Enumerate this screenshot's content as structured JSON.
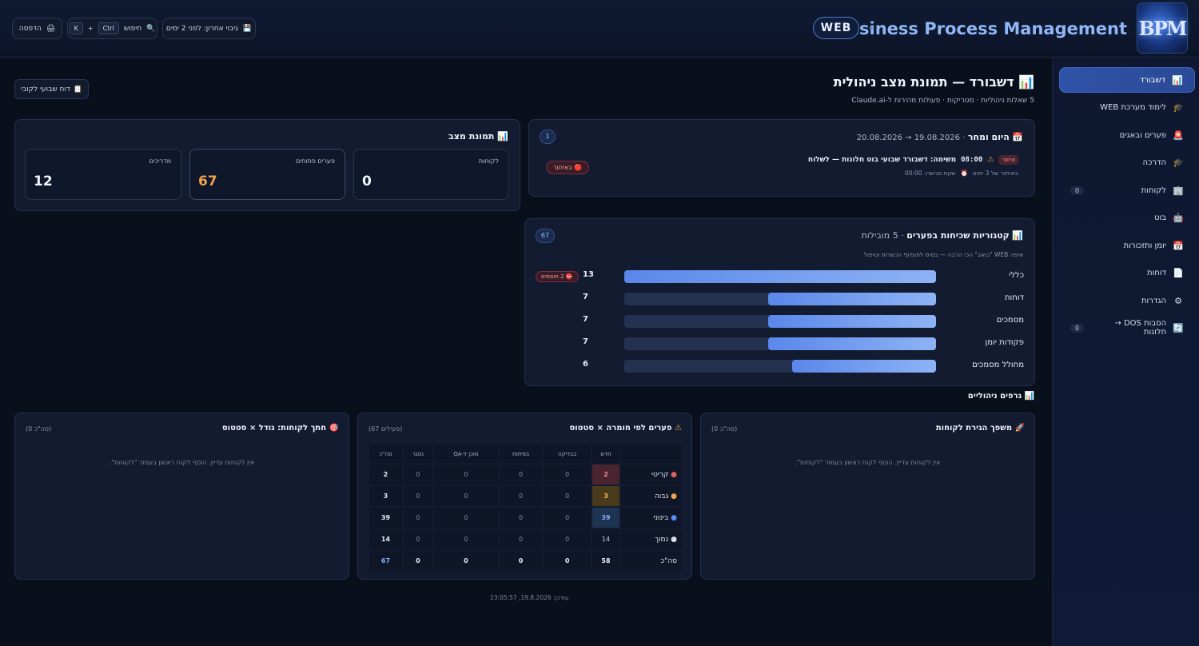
{
  "header": {
    "logo_text": "BPM",
    "app_title": "Business Process Management",
    "badge": "WEB",
    "dot": "•",
    "backup_label": "גיבוי אחרון: לפני 2 ימים",
    "search_label": "חיפוש",
    "kbd_ctrl": "Ctrl",
    "kbd_plus": "+",
    "kbd_k": "K",
    "print_label": "הדפסה"
  },
  "sidebar": {
    "items": [
      {
        "label": "דשבורד",
        "icon": "📊",
        "count": ""
      },
      {
        "label": "לימוד מערכת WEB",
        "icon": "🎓",
        "count": ""
      },
      {
        "label": "פערים ובאגים",
        "icon": "🚨",
        "count": ""
      },
      {
        "label": "הדרכה",
        "icon": "🎓",
        "count": ""
      },
      {
        "label": "לקוחות",
        "icon": "🏢",
        "count": "0"
      },
      {
        "label": "בוט",
        "icon": "🤖",
        "count": ""
      },
      {
        "label": "יומן ותזכורות",
        "icon": "📅",
        "count": ""
      },
      {
        "label": "דוחות",
        "icon": "📄",
        "count": ""
      },
      {
        "label": "הגדרות",
        "icon": "⚙",
        "count": ""
      },
      {
        "label": "הסבות DOS → חלונות",
        "icon": "🔄",
        "count": "0"
      }
    ]
  },
  "page": {
    "title": "דשבורד — תמונת מצב ניהולית",
    "title_icon": "📊",
    "subtitle": "5 שאלות ניהוליות · מטריקות · פעולות מהירות ל-Claude.ai",
    "weekly_report": "דוח שבועי לקובי",
    "weekly_icon": "📋"
  },
  "status": {
    "title": "תמונת מצב",
    "icon": "📊",
    "stats": [
      {
        "label": "לקוחות",
        "value": "0",
        "color": "#f2f5fb"
      },
      {
        "label": "פערים פתוחים",
        "value": "67",
        "color": "#f0a24b"
      },
      {
        "label": "מדריכים",
        "value": "12",
        "color": "#f2f5fb"
      }
    ]
  },
  "today": {
    "title": "היום ומחר",
    "icon": "📅",
    "range": "· 19.08.2026 → 20.08.2026",
    "count": "1",
    "task_time": "08:00",
    "task_text": "משימה: דשבורד שבועי בוט חלונות — לשלוח",
    "late_tag": "איחור",
    "late_by": "באיחור של 3 ימים",
    "meet_time": "שעת פגישה: 00:00",
    "status_btn": "באיחור"
  },
  "categories": {
    "title": "קטגוריות שכיחות בפערים",
    "icon": "📊",
    "suffix": "· 5 מובילות",
    "subtitle": "איפה WEB \"כואב\" הכי הרבה — בסיס לתעדוף הכשרות וטיפול",
    "count": "67",
    "missing": "2 חוסמים",
    "rows": [
      {
        "label": "כללי",
        "value": 13
      },
      {
        "label": "דוחות",
        "value": 7
      },
      {
        "label": "מסמכים",
        "value": 7
      },
      {
        "label": "פקודות יומן",
        "value": 7
      },
      {
        "label": "מחולל מסמכים",
        "value": 6
      }
    ]
  },
  "charts_heading": {
    "title": "גרפים ניהוליים",
    "icon": "📊"
  },
  "launch": {
    "title": "משפך הגירת לקוחות",
    "icon": "🚀",
    "total": "(0 סה\"כ)",
    "empty": "אין לקוחות עדיין. הוסף לקוח ראשון בעמוד \"לקוחות\"."
  },
  "gaps": {
    "title": "פערים לפי חומרה × סטטוס",
    "icon": "⚠",
    "total": "(67 פעילים)",
    "columns": [
      "חדש",
      "בבדיקה",
      "בפיתוח",
      "מוכן ל-QA",
      "נסגר",
      "סה\"כ"
    ],
    "rows": [
      {
        "label": "קריטי",
        "dot": "#e0625c",
        "cells": [
          "2",
          "0",
          "0",
          "0",
          "0",
          "2"
        ],
        "hl": "#4a2430",
        "hlc": "#f08a8a"
      },
      {
        "label": "גבוה",
        "dot": "#f0a24b",
        "cells": [
          "3",
          "0",
          "0",
          "0",
          "0",
          "3"
        ],
        "hl": "#4a3a1c",
        "hlc": "#f0c050"
      },
      {
        "label": "בינוני",
        "dot": "#5a8ef0",
        "cells": [
          "39",
          "0",
          "0",
          "0",
          "0",
          "39"
        ],
        "hl": "#1f3452",
        "hlc": "#7fb0ff"
      },
      {
        "label": "נמוך",
        "dot": "#d8dde8",
        "cells": [
          "14",
          "0",
          "0",
          "0",
          "0",
          "14"
        ],
        "hl": "",
        "hlc": ""
      },
      {
        "label": "סה\"כ",
        "dot": "",
        "cells": [
          "58",
          "0",
          "0",
          "0",
          "0",
          "67"
        ],
        "hl": "",
        "hlc": ""
      }
    ]
  },
  "market": {
    "title": "חתך לקוחות: גודל × סטטוס",
    "icon": "🎯",
    "total": "(0 סה\"כ)",
    "empty": "אין לקוחות עדיין. הוסף לקוח ראשון בעמוד \"לקוחות\"."
  },
  "footer": {
    "updated": "עודכן: 19.8.2026, 23:05:57"
  }
}
